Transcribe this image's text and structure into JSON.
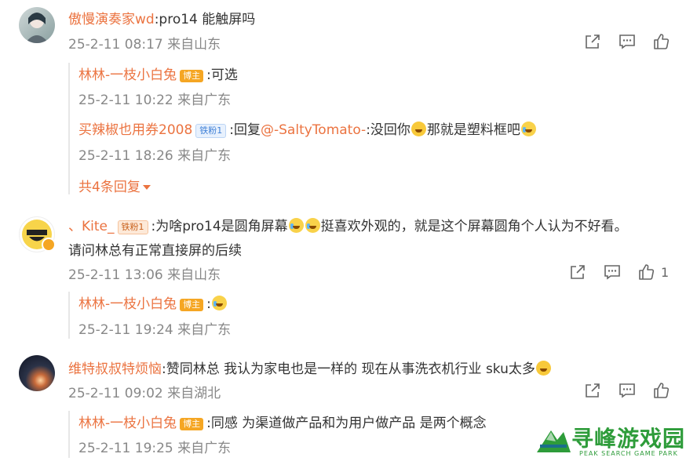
{
  "comments": [
    {
      "user": "傲慢演奏家wd",
      "text": ":pro14 能触屏吗",
      "meta": "25-2-11 08:17 来自山东",
      "replies": [
        {
          "user": "林林-一枝小白兔",
          "badge": "博主",
          "text": ":可选",
          "meta": "25-2-11 10:22 来自广东"
        },
        {
          "user": "买辣椒也用券2008",
          "badge": "铁粉1",
          "text_a": ":回复",
          "mention": "@-SaltyTomato-",
          "text_b": ":没回你",
          "text_c": "那就是塑料框吧",
          "meta": "25-2-11 18:26 来自广东"
        }
      ],
      "more": "共4条回复"
    },
    {
      "user": "、Kite_",
      "badge": "铁粉1",
      "text_a": ":为啥pro14是圆角屏幕",
      "text_b": "挺喜欢外观的，就是这个屏幕圆角个人认为不好看。",
      "text_line2": "请问林总有正常直接屏的后续",
      "meta": "25-2-11 13:06 来自山东",
      "likes": "1",
      "replies": [
        {
          "user": "林林-一枝小白兔",
          "badge": "博主",
          "text": ":",
          "meta": "25-2-11 19:24 来自广东"
        }
      ]
    },
    {
      "user": "维特叔叔特烦恼",
      "text": ":赞同林总 我认为家电也是一样的 现在从事洗衣机行业 sku太多",
      "meta": "25-2-11 09:02 来自湖北",
      "replies": [
        {
          "user": "林林-一枝小白兔",
          "badge": "博主",
          "text": ":同感 为渠道做产品和为用户做产品 是两个概念",
          "meta": "25-2-11 19:25 来自广东"
        }
      ]
    }
  ],
  "watermark": {
    "title": "寻峰游戏园",
    "subtitle": "PEAK SEARCH GAME PARK"
  },
  "icons": {
    "share": "share-icon",
    "comment": "comment-icon",
    "like": "like-icon"
  },
  "colors": {
    "username": "#eb7340",
    "text": "#333333",
    "meta": "#888888",
    "host_badge": "#f5a623"
  }
}
